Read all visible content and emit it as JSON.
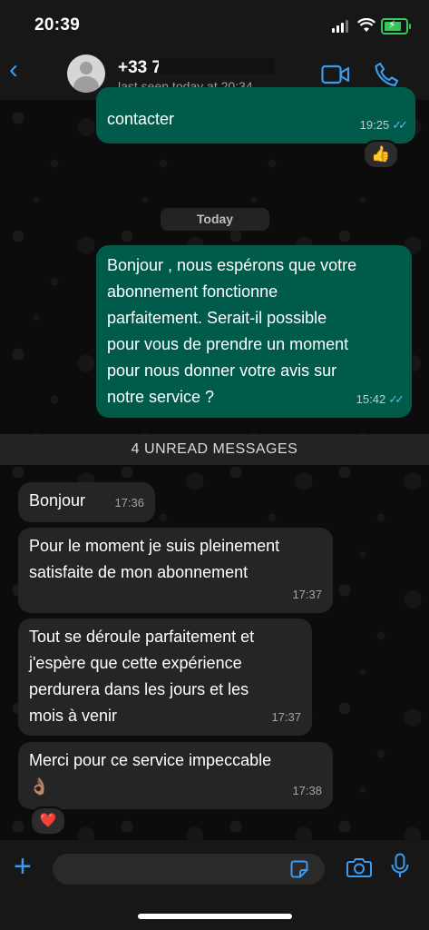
{
  "status_bar": {
    "time": "20:39"
  },
  "header": {
    "contact_name": "+33 7",
    "last_seen": "last seen today at 20:34"
  },
  "date_label": "Today",
  "unread_banner": "4 UNREAD MESSAGES",
  "messages": [
    {
      "direction": "outgoing",
      "text": "contacter",
      "time": "19:25",
      "reaction": "👍"
    },
    {
      "direction": "outgoing",
      "text": "Bonjour , nous espérons que votre\nabonnement fonctionne\nparfaitement. Serait-il possible\npour vous de prendre un moment\npour nous donner votre avis sur\nnotre service ?",
      "time": "15:42"
    },
    {
      "direction": "incoming",
      "text": "Bonjour",
      "time": "17:36"
    },
    {
      "direction": "incoming",
      "text": "Pour le moment je suis pleinement\nsatisfaite de mon abonnement",
      "time": "17:37"
    },
    {
      "direction": "incoming",
      "text": "Tout se déroule parfaitement et\nj'espère que cette expérience\nperdurera dans les jours et les\nmois à venir",
      "time": "17:37"
    },
    {
      "direction": "incoming",
      "text": "Merci pour ce service impeccable\n👌🏽",
      "time": "17:38",
      "reaction": "❤️"
    }
  ],
  "input": {
    "placeholder": ""
  },
  "colors": {
    "outgoing_bubble": "#005b4b",
    "incoming_bubble": "#252525",
    "accent": "#3a9bf0",
    "read_ticks": "#53bdeb"
  }
}
